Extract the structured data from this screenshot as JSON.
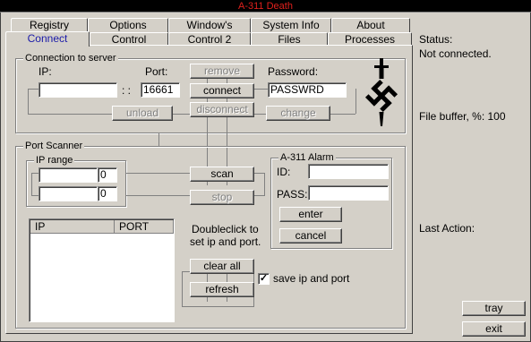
{
  "window": {
    "title": "A-311 Death"
  },
  "tabs_row1": [
    "Registry",
    "Options",
    "Window's",
    "System Info",
    "About"
  ],
  "tabs_row2": [
    "Connect",
    "Control",
    "Control 2",
    "Files",
    "Processes"
  ],
  "active_tab": "Connect",
  "connection": {
    "group_title": "Connection to server",
    "ip_label": "IP:",
    "ip_value": "",
    "separator": ": :",
    "port_label": "Port:",
    "port_value": "16661",
    "password_label": "Password:",
    "password_value": "PASSWRD",
    "buttons": {
      "remove": "remove",
      "connect": "connect",
      "disconnect": "disconnect",
      "unload": "unload",
      "change": "change"
    }
  },
  "scanner": {
    "group_title": "Port Scanner",
    "ip_range_title": "IP range",
    "range_start": "",
    "range_start_num": "0",
    "range_end": "",
    "range_end_num": "0",
    "scan_label": "scan",
    "stop_label": "stop",
    "columns": [
      "IP",
      "PORT"
    ],
    "hint_line1": "Doubleclick to",
    "hint_line2": "set ip and port.",
    "clear_all_label": "clear all",
    "refresh_label": "refresh",
    "save_checkbox_label": "save ip and port",
    "save_checked": true
  },
  "alarm": {
    "group_title": "A-311 Alarm",
    "id_label": "ID:",
    "id_value": "",
    "pass_label": "PASS:",
    "pass_value": "",
    "enter_label": "enter",
    "cancel_label": "cancel"
  },
  "sidebar": {
    "status_label": "Status:",
    "status_value": "Not connected.",
    "file_buffer": "File buffer, %: 100",
    "last_action_label": "Last Action:",
    "tray_label": "tray",
    "exit_label": "exit"
  },
  "logo": {
    "icon": "swastika-dagger-emblem",
    "color": "#000000"
  },
  "colors": {
    "title_text": "#e0201c",
    "title_bg": "#000000",
    "face": "#d4d0c8",
    "active_tab_text": "#1a1aa8"
  }
}
